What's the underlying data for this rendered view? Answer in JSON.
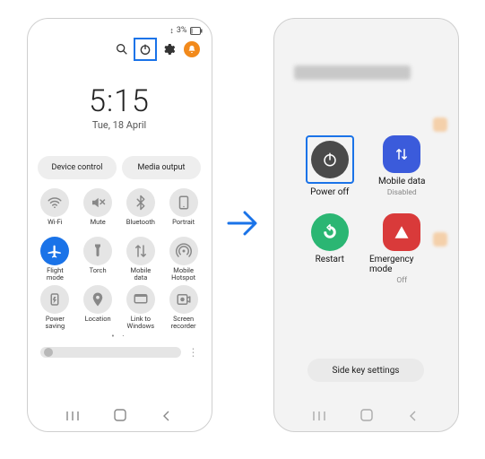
{
  "status": {
    "battery_text": "3%",
    "indicator_glyph": "↕"
  },
  "top_actions": {
    "search": "search",
    "power": "power",
    "settings": "settings",
    "notifications": "notifications"
  },
  "clock": {
    "time": "5:15",
    "date": "Tue, 18 April"
  },
  "pills": {
    "device_control": "Device control",
    "media_output": "Media output"
  },
  "quick_settings": [
    {
      "id": "wifi",
      "label": "Wi-Fi",
      "active": false,
      "icon": "wifi"
    },
    {
      "id": "mute",
      "label": "Mute",
      "active": false,
      "icon": "mute"
    },
    {
      "id": "bluetooth",
      "label": "Bluetooth",
      "active": false,
      "icon": "bluetooth"
    },
    {
      "id": "portrait",
      "label": "Portrait",
      "active": false,
      "icon": "portrait"
    },
    {
      "id": "flight-mode",
      "label": "Flight\nmode",
      "active": true,
      "icon": "airplane"
    },
    {
      "id": "torch",
      "label": "Torch",
      "active": false,
      "icon": "torch"
    },
    {
      "id": "mobile-data",
      "label": "Mobile\ndata",
      "active": false,
      "icon": "mobiledata"
    },
    {
      "id": "mobile-hotspot",
      "label": "Mobile\nHotspot",
      "active": false,
      "icon": "hotspot"
    },
    {
      "id": "power-saving",
      "label": "Power\nsaving",
      "active": false,
      "icon": "powersave"
    },
    {
      "id": "location",
      "label": "Location",
      "active": false,
      "icon": "location"
    },
    {
      "id": "link-to-windows",
      "label": "Link to\nWindows",
      "active": false,
      "icon": "link"
    },
    {
      "id": "screen-recorder",
      "label": "Screen\nrecorder",
      "active": false,
      "icon": "record"
    }
  ],
  "pager": "• ·",
  "power_menu": {
    "items": [
      {
        "id": "power-off",
        "label": "Power off",
        "sub": "",
        "style": "dark",
        "highlight": true,
        "icon": "power"
      },
      {
        "id": "mobile-data",
        "label": "Mobile data",
        "sub": "Disabled",
        "style": "blue",
        "highlight": false,
        "icon": "updown"
      },
      {
        "id": "restart",
        "label": "Restart",
        "sub": "",
        "style": "green",
        "highlight": false,
        "icon": "restart"
      },
      {
        "id": "emergency",
        "label": "Emergency mode",
        "sub": "Off",
        "style": "red",
        "highlight": false,
        "icon": "emergency"
      }
    ],
    "side_key": "Side key settings"
  }
}
